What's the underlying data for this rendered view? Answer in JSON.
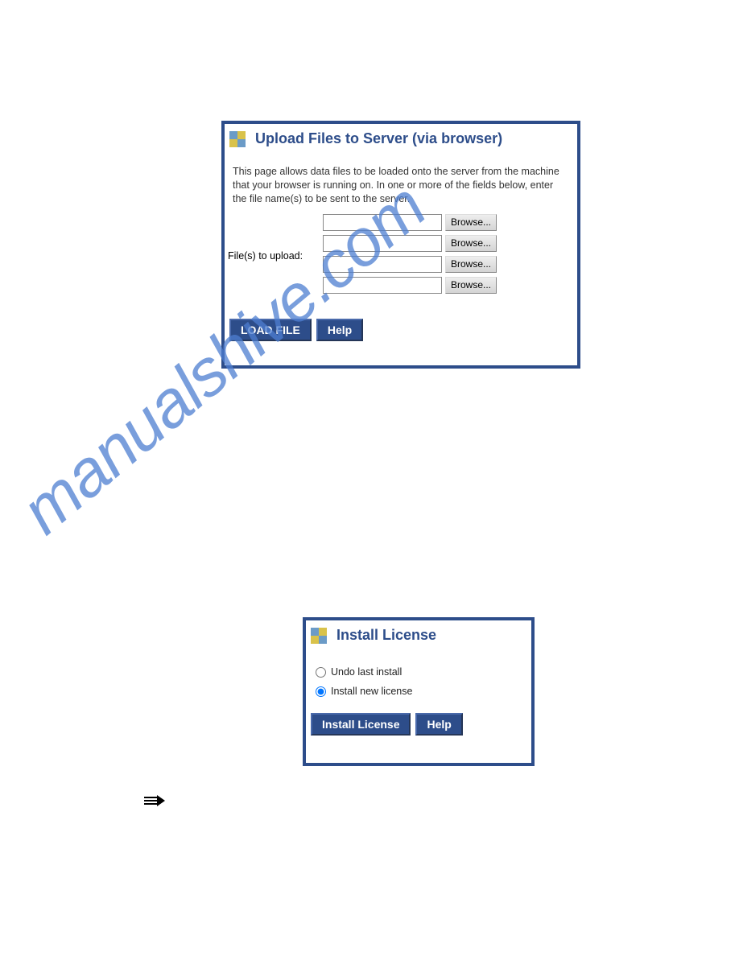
{
  "watermark": "manualshive.com",
  "upload_panel": {
    "title": "Upload Files to Server (via browser)",
    "description": "This page allows data files to be loaded onto the server from the machine that your browser is running on. In one or more of the fields below, enter the file name(s) to be sent to the server.",
    "label": "File(s) to upload:",
    "rows": [
      {
        "value": "",
        "browse": "Browse..."
      },
      {
        "value": "",
        "browse": "Browse..."
      },
      {
        "value": "",
        "browse": "Browse..."
      },
      {
        "value": "",
        "browse": "Browse..."
      }
    ],
    "load_button": "LOAD FILE",
    "help_button": "Help"
  },
  "license_panel": {
    "title": "Install License",
    "options": {
      "undo": "Undo last install",
      "install": "Install new license"
    },
    "selected": "install",
    "install_button": "Install License",
    "help_button": "Help"
  }
}
